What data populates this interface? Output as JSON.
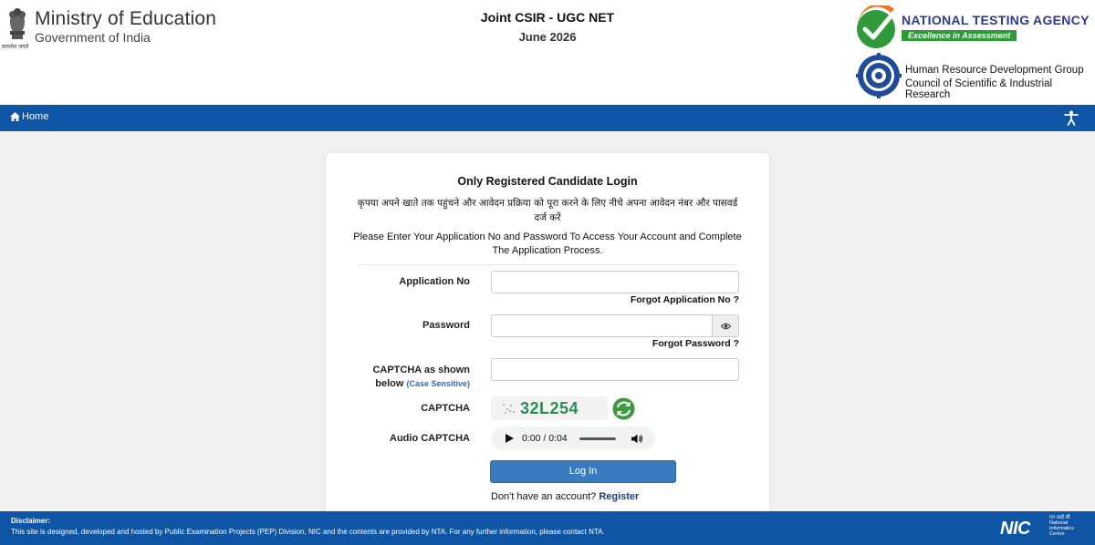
{
  "header": {
    "emblem_caption": "सत्यमेव जयते",
    "ministry_title": "Ministry of Education",
    "ministry_subtitle": "Government of India",
    "exam_title": "Joint CSIR - UGC NET",
    "exam_session": "June 2026",
    "nta_name": "NATIONAL TESTING AGENCY",
    "nta_tagline": "Excellence in Assessment",
    "csir_line1": "Human Resource Development Group",
    "csir_line2": "Council of Scientific & Industrial Research"
  },
  "nav": {
    "home_label": "Home"
  },
  "login": {
    "title": "Only Registered Candidate Login",
    "hindi_instruction": "कृपया अपने खाते तक पहुंचने और आवेदन प्रक्रिया को पूरा करने के लिए नीचे अपना आवेदन नंबर और पासवर्ड दर्ज करें",
    "english_instruction": "Please Enter Your Application No and Password To Access Your Account and Complete The Application Process.",
    "application_label": "Application No",
    "application_value": "",
    "forgot_application": "Forgot Application No ?",
    "password_label": "Password",
    "password_value": "",
    "forgot_password": "Forgot Password ?",
    "captcha_input_label": "CAPTCHA as shown below",
    "captcha_case_note": "(Case Sensitive)",
    "captcha_value": "",
    "captcha_label": "CAPTCHA",
    "captcha_text": "32L254",
    "audio_captcha_label": "Audio CAPTCHA",
    "audio_time": "0:00 / 0:04",
    "login_button": "Log In",
    "register_prompt": "Don't have an account?",
    "register_link": "Register"
  },
  "footer": {
    "disclaimer_title": "Disclaimer:",
    "disclaimer_text": "This site is designed, developed and hosted by Public Examination Projects (PEP) Division, NIC and the contents are provided by NTA. For any further information, please contact NTA.",
    "nic_logo": "NIC",
    "nic_hindi": "एन आई सी",
    "nic_text": "National Informatics Centre"
  },
  "icons": {
    "nav_home": "home-icon",
    "accessibility": "accessibility-icon",
    "show_password": "eye-icon",
    "captcha_refresh": "refresh-icon",
    "audio_play": "play-icon",
    "audio_volume": "volume-icon"
  },
  "colors": {
    "navbar": "#0e55a6",
    "footer": "#0e55a6",
    "login_button": "#3a7bbf",
    "nta_blue": "#2d3a8c",
    "nta_green": "#2e9a3a",
    "captcha_text": "#2e8b57",
    "page_background": "#f0f0f0"
  }
}
